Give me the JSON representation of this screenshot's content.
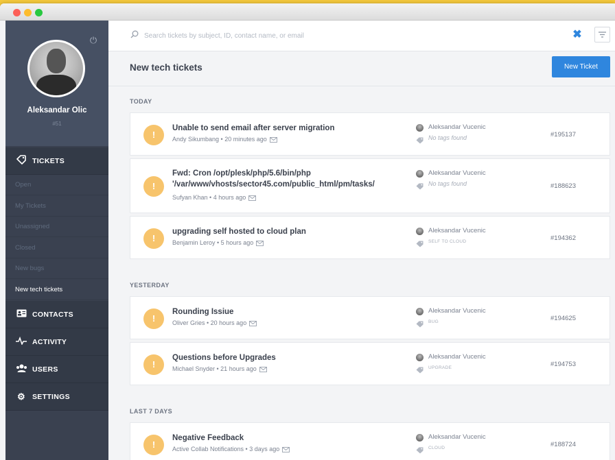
{
  "window": {
    "controls": [
      "close",
      "minimize",
      "maximize"
    ]
  },
  "user": {
    "name": "Aleksandar Olic",
    "subtitle": "#51"
  },
  "sidebar": {
    "tickets": {
      "label": "TICKETS",
      "icon": "tag-icon"
    },
    "ticket_filters": [
      {
        "label": "Open",
        "active": false
      },
      {
        "label": "My Tickets",
        "active": false
      },
      {
        "label": "Unassigned",
        "active": false
      },
      {
        "label": "Closed",
        "active": false
      },
      {
        "label": "New bugs",
        "active": false
      },
      {
        "label": "New tech tickets",
        "active": true
      }
    ],
    "sections": [
      {
        "label": "CONTACTS",
        "icon": "contact-card-icon"
      },
      {
        "label": "ACTIVITY",
        "icon": "pulse-icon"
      },
      {
        "label": "USERS",
        "icon": "users-icon"
      },
      {
        "label": "SETTINGS",
        "icon": "gear-icon"
      }
    ]
  },
  "search": {
    "placeholder": "Search tickets by subject, ID, contact name, or email",
    "value": ""
  },
  "header": {
    "title": "New tech tickets",
    "new_ticket_label": "New Ticket"
  },
  "groups": [
    {
      "label": "TODAY",
      "tickets": [
        {
          "title": "Unable to send email after server migration",
          "meta": "Andy Sikumbang • 20 minutes ago",
          "assignee": "Aleksandar Vucenic",
          "tags": "No tags found",
          "id": "#195137"
        },
        {
          "title": "Fwd: Cron /opt/plesk/php/5.6/bin/php '/var/www/vhosts/sector45.com/public_html/pm/tasks/",
          "meta": "Sufyan Khan • 4 hours ago",
          "assignee": "Aleksandar Vucenic",
          "tags": "No tags found",
          "id": "#188623"
        },
        {
          "title": "upgrading self hosted to cloud plan",
          "meta": "Benjamin Leroy • 5 hours ago",
          "assignee": "Aleksandar Vucenic",
          "tags": "SELF TO CLOUD",
          "id": "#194362"
        }
      ]
    },
    {
      "label": "YESTERDAY",
      "tickets": [
        {
          "title": "Rounding Issiue",
          "meta": "Oliver Gries • 20 hours ago",
          "assignee": "Aleksandar Vucenic",
          "tags": "BUG",
          "id": "#194625"
        },
        {
          "title": "Questions before Upgrades",
          "meta": "Michael Snyder • 21 hours ago",
          "assignee": "Aleksandar Vucenic",
          "tags": "UPGRADE",
          "id": "#194753"
        }
      ]
    },
    {
      "label": "LAST 7 DAYS",
      "tickets": [
        {
          "title": "Negative Feedback",
          "meta": "Active Collab Notifications • 3 days ago",
          "assignee": "Aleksandar Vucenic",
          "tags": "CLOUD",
          "id": "#188724"
        }
      ]
    }
  ],
  "colors": {
    "sidebar": "#3a4150",
    "accent": "#2f86de",
    "priority_badge": "#f7c46c",
    "background": "#f3f4f6"
  }
}
